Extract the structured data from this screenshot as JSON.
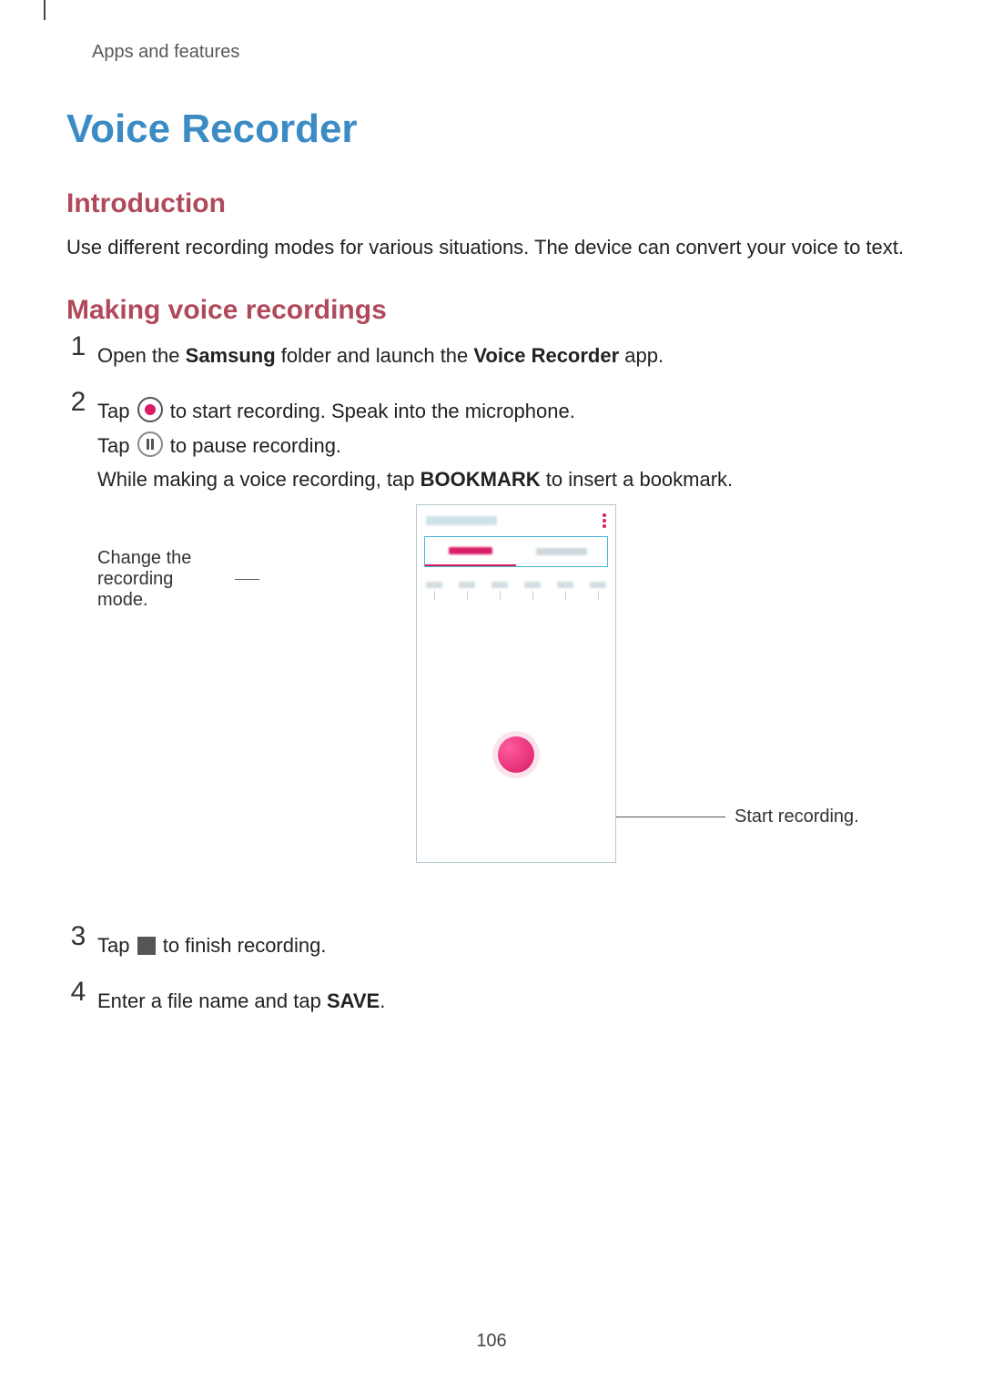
{
  "header": {
    "breadcrumb": "Apps and features"
  },
  "title": "Voice Recorder",
  "sections": {
    "intro": {
      "heading": "Introduction",
      "body": "Use different recording modes for various situations. The device can convert your voice to text."
    },
    "making": {
      "heading": "Making voice recordings"
    }
  },
  "steps": {
    "s1": {
      "pre": "Open the ",
      "b1": "Samsung",
      "mid": " folder and launch the ",
      "b2": "Voice Recorder",
      "post": " app."
    },
    "s2": {
      "line1_pre": "Tap ",
      "line1_post": " to start recording. Speak into the microphone.",
      "line2_pre": "Tap ",
      "line2_post": " to pause recording.",
      "line3_pre": "While making a voice recording, tap ",
      "line3_b": "BOOKMARK",
      "line3_post": " to insert a bookmark."
    },
    "s3": {
      "pre": "Tap ",
      "post": " to finish recording."
    },
    "s4": {
      "pre": "Enter a file name and tap ",
      "b": "SAVE",
      "post": "."
    }
  },
  "figure": {
    "callout_left": "Change the recording mode.",
    "callout_right": "Start recording."
  },
  "page_number": "106"
}
